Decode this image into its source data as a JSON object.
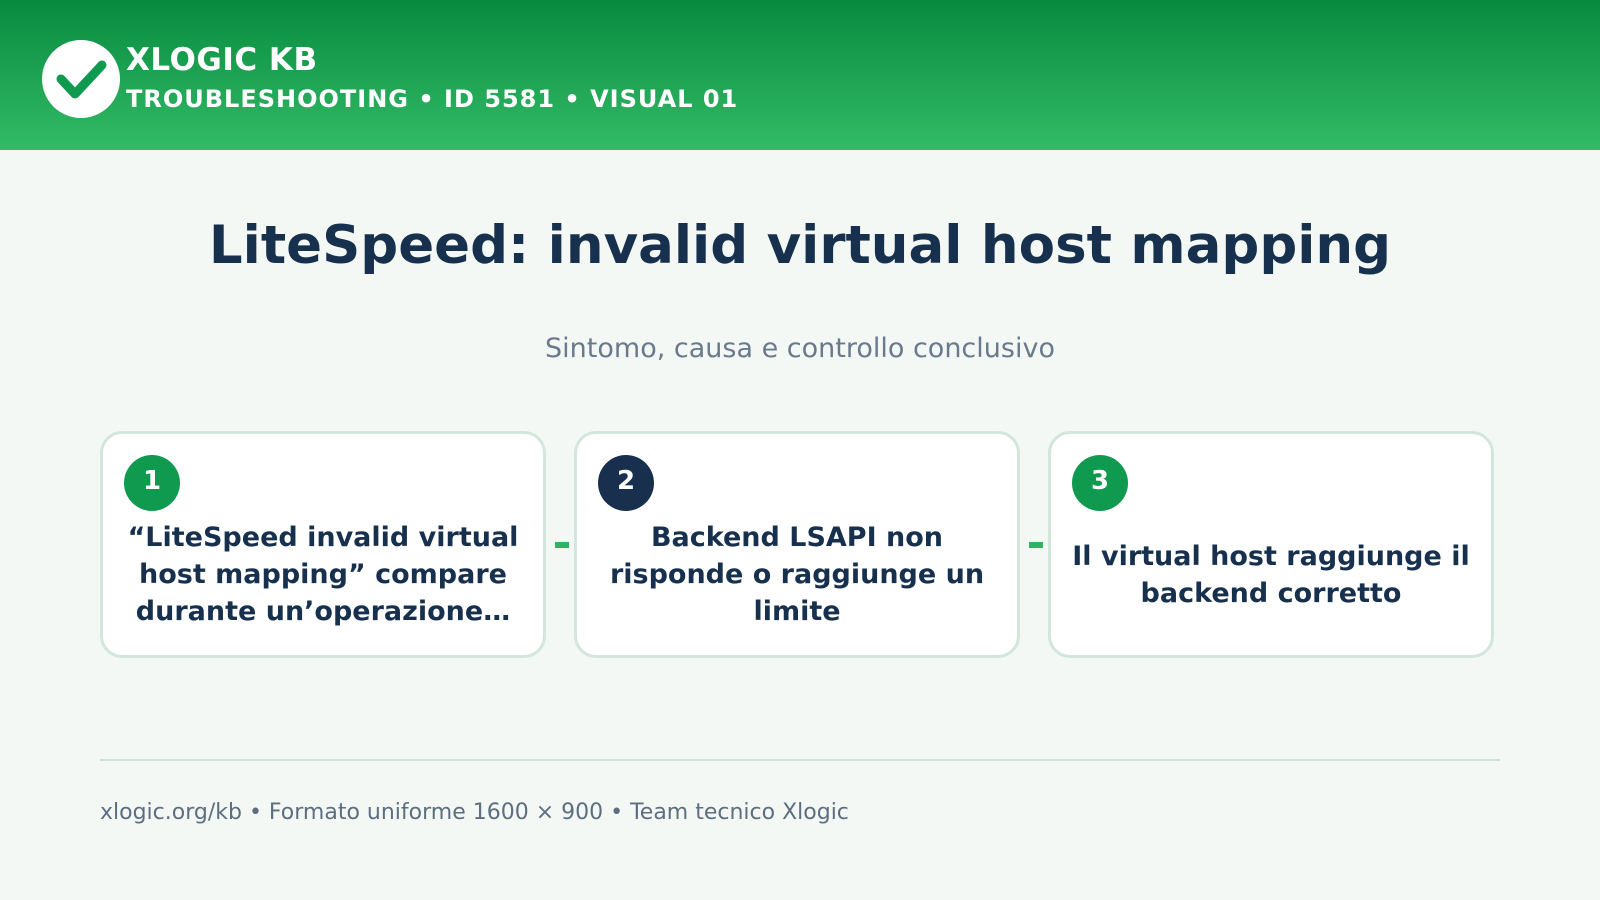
{
  "header": {
    "brand": "XLOGIC KB",
    "subtitle": "TROUBLESHOOTING • ID 5581 • VISUAL 01",
    "logo_icon": "checkmark-icon",
    "gradient_colors": [
      "#088a3e",
      "#32bb67"
    ]
  },
  "main": {
    "title": "LiteSpeed: invalid virtual host mapping",
    "subtitle": "Sintomo, causa e controllo conclusivo"
  },
  "steps": [
    {
      "number": "1",
      "text": "“LiteSpeed invalid virtual host mapping” compare durante un’operazione…",
      "badge_color": "#109a50"
    },
    {
      "number": "2",
      "text": "Backend LSAPI non risponde o raggiunge un limite",
      "badge_color": "#182f4e"
    },
    {
      "number": "3",
      "text": "Il virtual host raggiunge il backend corretto",
      "badge_color": "#109a50"
    }
  ],
  "footer": {
    "text": "xlogic.org/kb • Formato uniforme 1600 × 900 • Team tecnico Xlogic"
  },
  "colors": {
    "accent": "#2db463",
    "title": "#17304d",
    "background": "#f3f8f5"
  }
}
